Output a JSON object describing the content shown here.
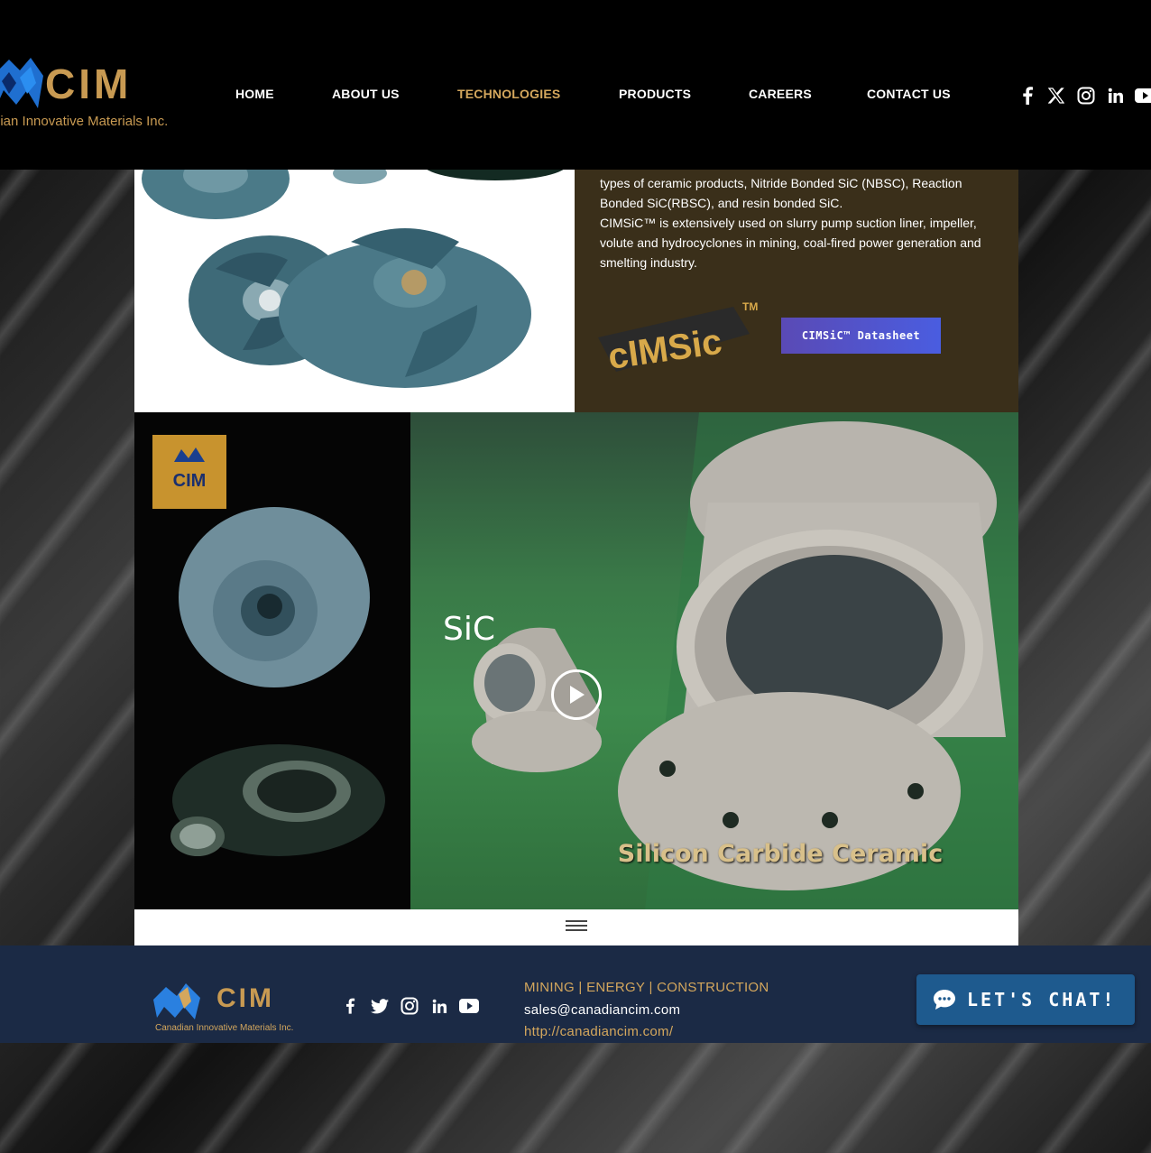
{
  "header": {
    "logo_text": "CIM",
    "logo_subtitle": "dian Innovative Materials Inc.",
    "nav": [
      {
        "label": "HOME"
      },
      {
        "label": "ABOUT US"
      },
      {
        "label": "TECHNOLOGIES",
        "active": true
      },
      {
        "label": "PRODUCTS"
      },
      {
        "label": "CAREERS"
      },
      {
        "label": "CONTACT US"
      }
    ],
    "social_icons": [
      "facebook-icon",
      "x-icon",
      "instagram-icon",
      "linkedin-icon",
      "youtube-icon"
    ]
  },
  "section": {
    "description": [
      "types of ceramic products, Nitride Bonded SiC (NBSC), Reaction Bonded SiC(RBSC), and resin bonded SiC.",
      "CIMSiC™ is extensively used on slurry pump suction liner, impeller, volute and hydrocyclones in mining, coal-fired power generation and smelting industry."
    ],
    "product_logo_text": "cIMSic",
    "product_logo_tm": "TM",
    "datasheet_button": "CIMSiC™ Datasheet",
    "badge_text": "CIM",
    "video": {
      "title": "SiC",
      "caption": "Silicon Carbide Ceramic"
    }
  },
  "footer": {
    "logo_text": "CIM",
    "logo_subtitle": "Canadian Innovative Materials Inc.",
    "social_icons": [
      "facebook-icon",
      "twitter-icon",
      "instagram-icon",
      "linkedin-icon",
      "youtube-icon"
    ],
    "tags": "MINING  | ENERGY | CONSTRUCTION",
    "email": "sales@canadiancim.com",
    "website": "http://canadiancim.com/"
  },
  "chat": {
    "label": "LET'S CHAT!"
  },
  "colors": {
    "accent_gold": "#d4a75d",
    "footer_bg": "#1b2a45",
    "chat_bg": "#1e5a8e",
    "panel_bg": "#3a2f1a"
  }
}
